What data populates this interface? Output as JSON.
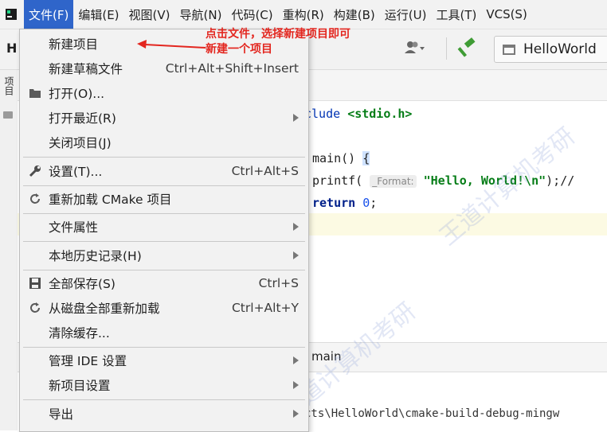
{
  "menubar": {
    "items": [
      "文件(F)",
      "编辑(E)",
      "视图(V)",
      "导航(N)",
      "代码(C)",
      "重构(R)",
      "构建(B)",
      "运行(U)",
      "工具(T)",
      "VCS(S)"
    ]
  },
  "toolbar": {
    "project_letter": "H",
    "run_config": "HelloWorld"
  },
  "left_strip": {
    "label": "项目"
  },
  "editor": {
    "line1_prefix": "clude ",
    "line1_header": "<stdio.h>",
    "line2_prefix": "main() ",
    "line2_brace": "{",
    "line3_call": "printf(",
    "line3_hint": "_Format:",
    "line3_string": "\"Hello, World!\\n\"",
    "line3_rest": ");//",
    "line4_kw": "return",
    "line4_num": "0",
    "line4_end": ";",
    "panel_label": "main",
    "path": "cts\\HelloWorld\\cmake-build-debug-mingw"
  },
  "dropdown": {
    "items": [
      {
        "label": "新建项目",
        "shortcut": "",
        "icon": ""
      },
      {
        "label": "新建草稿文件",
        "shortcut": "Ctrl+Alt+Shift+Insert",
        "icon": ""
      },
      {
        "label": "打开(O)...",
        "shortcut": "",
        "icon": "folder-icon"
      },
      {
        "label": "打开最近(R)",
        "shortcut": "",
        "icon": "",
        "submenu": true
      },
      {
        "label": "关闭项目(J)",
        "shortcut": "",
        "icon": ""
      },
      {
        "label": "设置(T)...",
        "shortcut": "Ctrl+Alt+S",
        "icon": "wrench-icon"
      },
      {
        "label": "重新加载 CMake 项目",
        "shortcut": "",
        "icon": "reload-icon"
      },
      {
        "label": "文件属性",
        "shortcut": "",
        "icon": "",
        "submenu": true
      },
      {
        "label": "本地历史记录(H)",
        "shortcut": "",
        "icon": "",
        "submenu": true
      },
      {
        "label": "全部保存(S)",
        "shortcut": "Ctrl+S",
        "icon": "save-icon"
      },
      {
        "label": "从磁盘全部重新加载",
        "shortcut": "Ctrl+Alt+Y",
        "icon": "reload-icon"
      },
      {
        "label": "清除缓存...",
        "shortcut": "",
        "icon": ""
      },
      {
        "label": "管理 IDE 设置",
        "shortcut": "",
        "icon": "",
        "submenu": true
      },
      {
        "label": "新项目设置",
        "shortcut": "",
        "icon": "",
        "submenu": true
      },
      {
        "label": "导出",
        "shortcut": "",
        "icon": "",
        "submenu": true
      }
    ]
  },
  "annotation": {
    "line1": "点击文件，选择新建项目即可",
    "line2": "新建一个项目"
  },
  "watermark": {
    "text": "王道计算机考研"
  },
  "colors": {
    "menu_active": "#2f65ca",
    "annotation_red": "#e3261f",
    "hammer_green": "#3f9c35"
  }
}
